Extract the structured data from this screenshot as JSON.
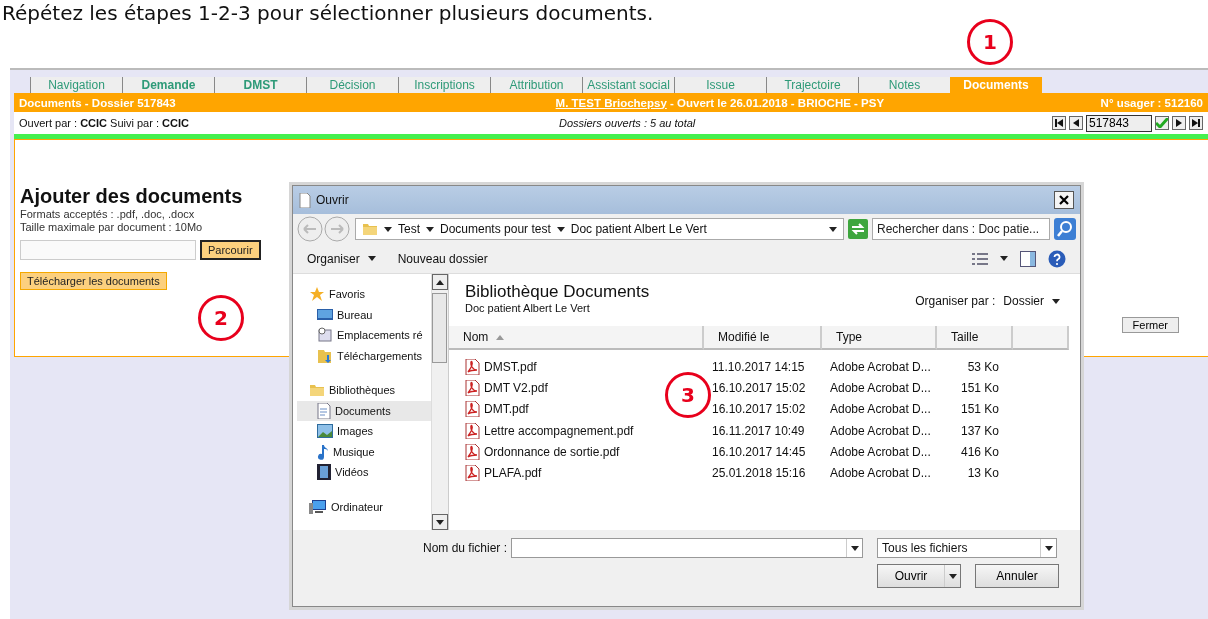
{
  "caption": "Répétez les étapes 1-2-3 pour sélectionner plusieurs documents.",
  "annotations": [
    "1",
    "2",
    "3"
  ],
  "tabs": [
    {
      "label": "Navigation",
      "selected": false,
      "bold": false
    },
    {
      "label": "Demande",
      "selected": false,
      "bold": true
    },
    {
      "label": "DMST",
      "selected": false,
      "bold": true
    },
    {
      "label": "Décision",
      "selected": false,
      "bold": false
    },
    {
      "label": "Inscriptions",
      "selected": false,
      "bold": false
    },
    {
      "label": "Attribution",
      "selected": false,
      "bold": false
    },
    {
      "label": "Assistant social",
      "selected": false,
      "bold": false
    },
    {
      "label": "Issue",
      "selected": false,
      "bold": false
    },
    {
      "label": "Trajectoire",
      "selected": false,
      "bold": false
    },
    {
      "label": "Notes",
      "selected": false,
      "bold": false
    },
    {
      "label": "Documents",
      "selected": true,
      "bold": true
    }
  ],
  "header": {
    "title": "Documents - Dossier  517843",
    "patient_link": "M. TEST Briochepsy",
    "patient_info": " - Ouvert le 26.01.2018 - BRIOCHE - PSY",
    "user_number": "N° usager : 512160"
  },
  "info_row": {
    "opened_by": "Ouvert par : **CCIC** Suivi par : **CCIC**",
    "open_files": "Dossiers ouverts : 5 au total",
    "record_number": "517843"
  },
  "upload": {
    "title": "Ajouter des documents",
    "formats": "Formats acceptés : .pdf, .doc, .docx",
    "max_size": "Taille maximale par document : 10Mo",
    "browse": "Parcourir",
    "upload_button": "Télécharger les documents",
    "close": "Fermer"
  },
  "dialog": {
    "title": "Ouvrir",
    "breadcrumb": [
      "Test",
      "Documents pour test",
      "Doc patient Albert Le Vert"
    ],
    "search": {
      "placeholder": "Rechercher dans : Doc patie..."
    },
    "toolbar": [
      "Organiser",
      "Nouveau dossier"
    ],
    "nav": [
      {
        "label": "Favoris",
        "items": [
          {
            "label": "Bureau",
            "selected": false
          },
          {
            "label": "Emplacements ré",
            "selected": false
          },
          {
            "label": "Téléchargements",
            "selected": false
          }
        ]
      },
      {
        "label": "Bibliothèques",
        "items": [
          {
            "label": "Documents",
            "selected": true
          },
          {
            "label": "Images",
            "selected": false
          },
          {
            "label": "Musique",
            "selected": false
          },
          {
            "label": "Vidéos",
            "selected": false
          }
        ]
      },
      {
        "label": "Ordinateur"
      }
    ],
    "library_title": "Bibliothèque Documents",
    "library_subtitle": "Doc patient Albert Le Vert",
    "arrange_label": "Organiser par :",
    "arrange_value": "Dossier",
    "columns": [
      "Nom",
      "Modifié le",
      "Type",
      "Taille"
    ],
    "files": [
      {
        "name": "DMST.pdf",
        "modified": "11.10.2017 14:15",
        "type": "Adobe Acrobat D...",
        "size": "53 Ko"
      },
      {
        "name": "DMT V2.pdf",
        "modified": "16.10.2017 15:02",
        "type": "Adobe Acrobat D...",
        "size": "151 Ko"
      },
      {
        "name": "DMT.pdf",
        "modified": "16.10.2017 15:02",
        "type": "Adobe Acrobat D...",
        "size": "151 Ko"
      },
      {
        "name": "Lettre accompagnement.pdf",
        "modified": "16.11.2017 10:49",
        "type": "Adobe Acrobat D...",
        "size": "137 Ko"
      },
      {
        "name": "Ordonnance de sortie.pdf",
        "modified": "16.10.2017 14:45",
        "type": "Adobe Acrobat D...",
        "size": "416 Ko"
      },
      {
        "name": "PLAFA.pdf",
        "modified": "25.01.2018 15:16",
        "type": "Adobe Acrobat D...",
        "size": "13 Ko"
      }
    ],
    "filename_label": "Nom du fichier :",
    "filter": "Tous les fichiers",
    "open": "Ouvrir",
    "cancel": "Annuler"
  }
}
